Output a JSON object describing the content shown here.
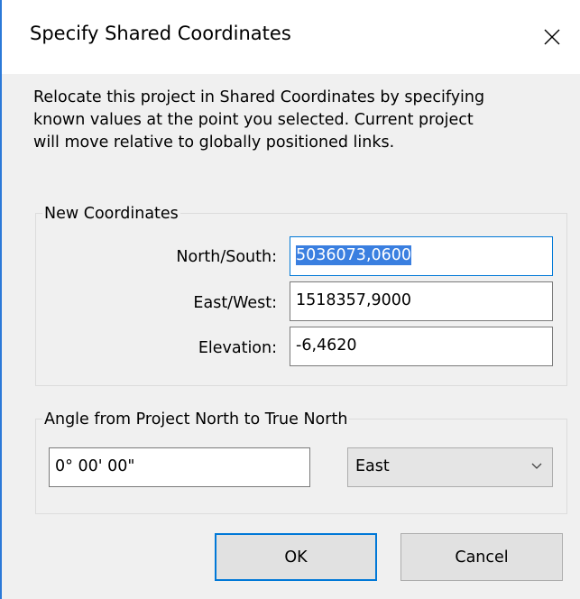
{
  "window": {
    "title": "Specify Shared Coordinates",
    "close_icon": "close-icon"
  },
  "description": "Relocate this project in Shared Coordinates by specifying\nknown values at the point you selected. Current project\nwill move relative to globally positioned links.",
  "new_coordinates": {
    "group_label": "New Coordinates",
    "north_south": {
      "label": "North/South:",
      "value": "5036073,0600"
    },
    "east_west": {
      "label": "East/West:",
      "value": "1518357,9000"
    },
    "elevation": {
      "label": "Elevation:",
      "value": "-6,4620"
    }
  },
  "angle": {
    "group_label": "Angle from Project North to True North",
    "value": "0° 00' 00\"",
    "direction": "East",
    "dropdown_icon": "chevron-down-icon"
  },
  "buttons": {
    "ok": "OK",
    "cancel": "Cancel"
  },
  "colors": {
    "accent": "#0078d7",
    "selection": "#3a7fe0",
    "dialog_background": "#f0f0f0"
  }
}
